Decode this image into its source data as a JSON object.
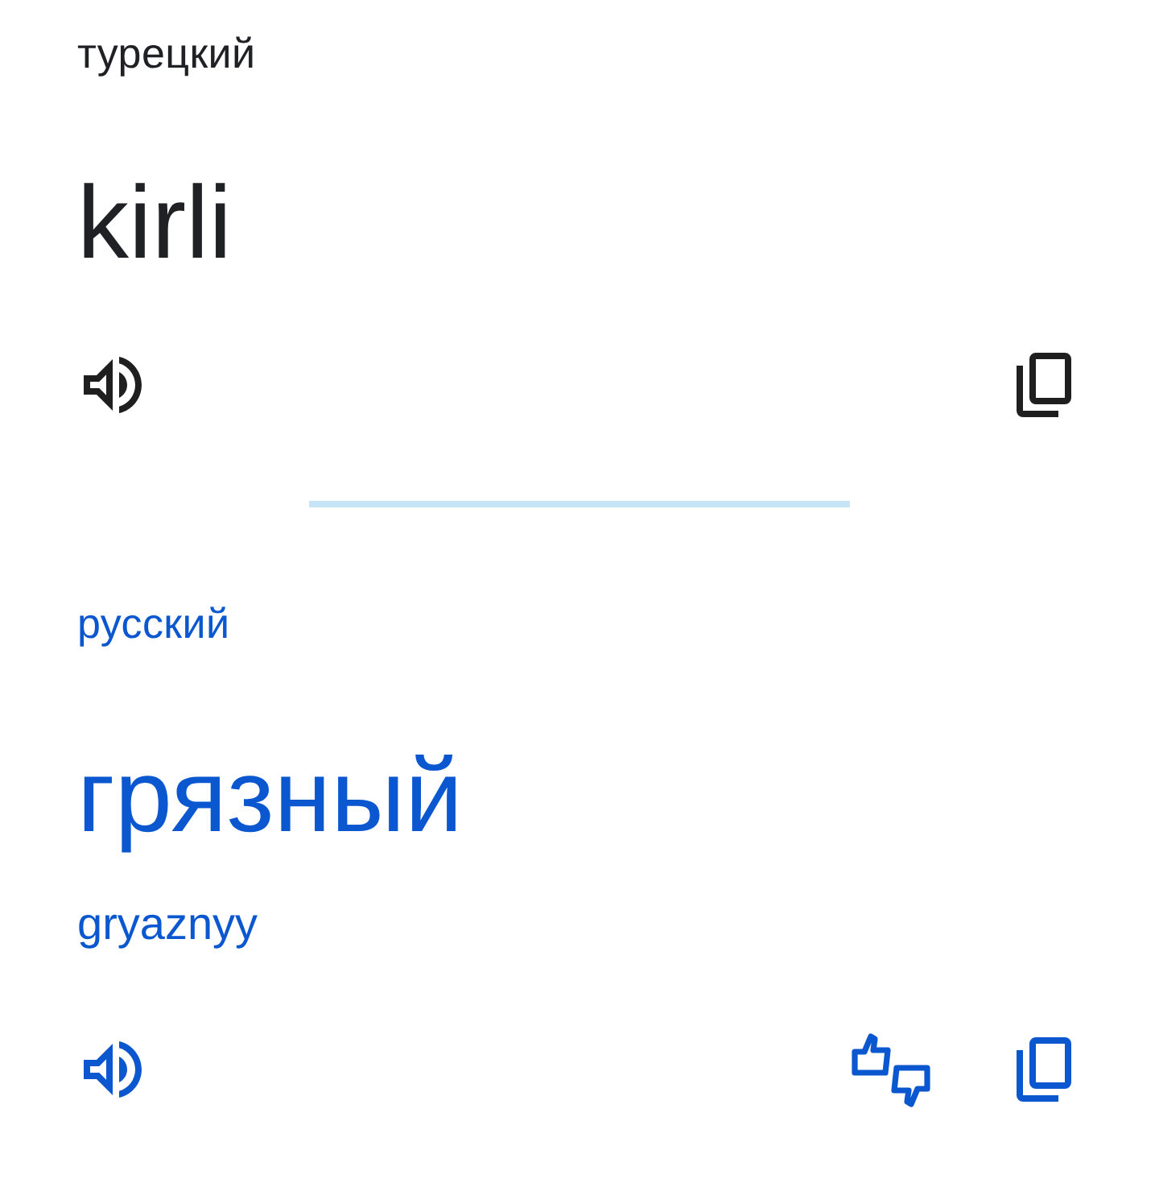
{
  "panels": [
    {
      "kind": "source",
      "language": "турецкий",
      "text": "kirli",
      "actions": [
        {
          "kind": "listen"
        },
        {
          "kind": "copy"
        }
      ]
    },
    {
      "kind": "target",
      "language": "русский",
      "text": "грязный",
      "transliteration": "gryaznyy",
      "actions": [
        {
          "kind": "listen"
        },
        {
          "kind": "feedback"
        },
        {
          "kind": "copy"
        }
      ]
    }
  ]
}
